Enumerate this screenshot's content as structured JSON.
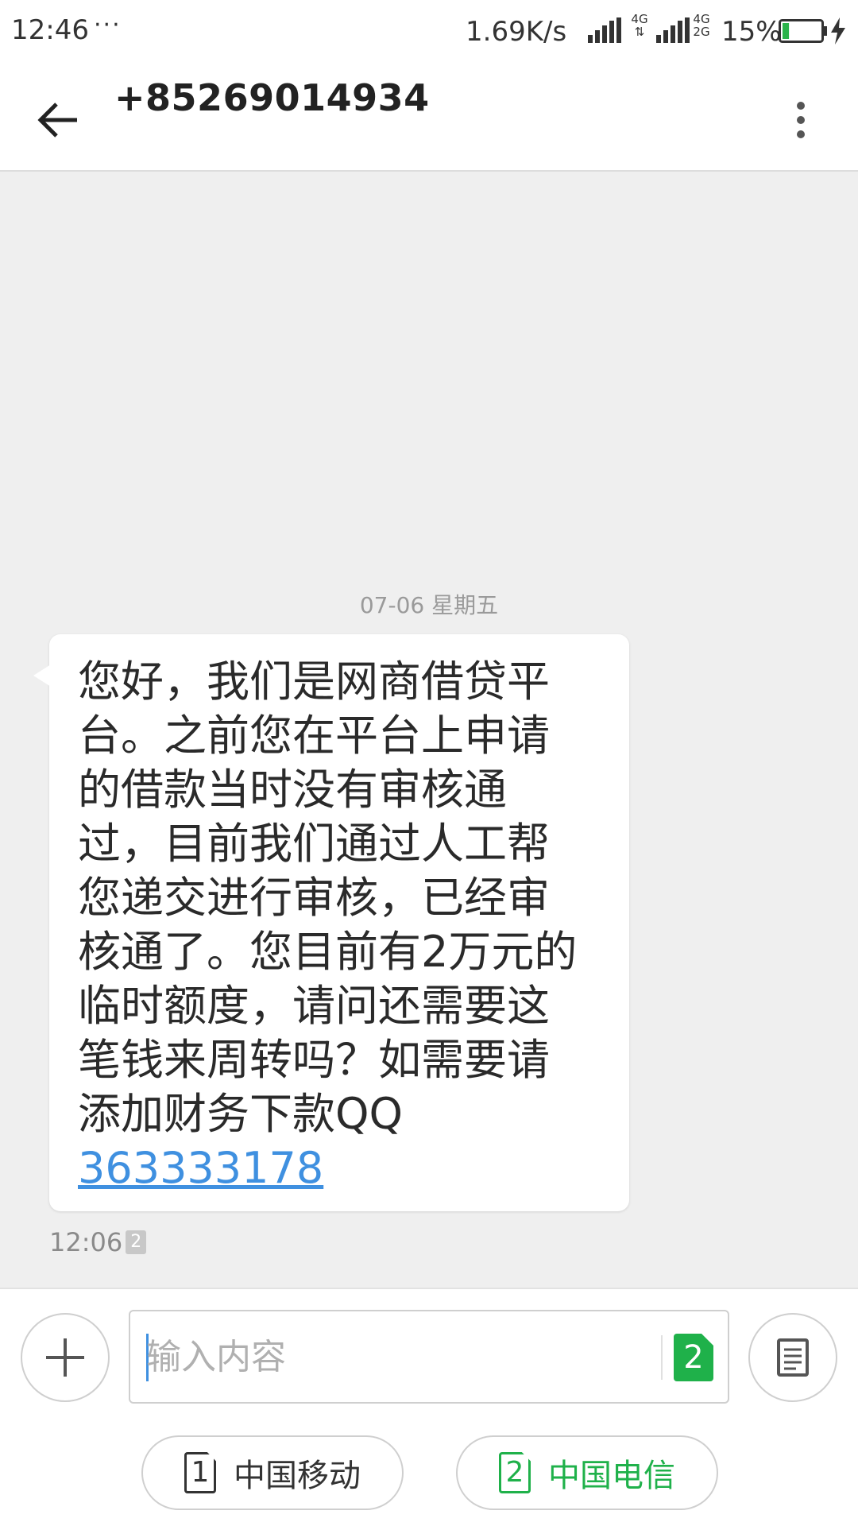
{
  "status_bar": {
    "time": "12:46",
    "more": "···",
    "net_speed": "1.69K/s",
    "network1": "4G",
    "network2_top": "4G",
    "network2_bottom": "2G",
    "battery_pct": "15%",
    "battery_level": 0.15,
    "battery_color": "#2ab34a"
  },
  "header": {
    "contact": "+85269014934"
  },
  "conversation": {
    "date": "07-06  星期五",
    "message_text": "您好，我们是网商借贷平台。之前您在平台上申请的借款当时没有审核通过，目前我们通过人工帮您递交进行审核，已经审核通了。您目前有2万元的临时额度，请问还需要这笔钱来周转吗？如需要请添加财务下款QQ",
    "message_link": "363333178",
    "time": "12:06",
    "sim_badge": "2"
  },
  "composer": {
    "placeholder": "输入内容",
    "send_sim": "2",
    "sim1_number": "1",
    "sim1_label": "中国移动",
    "sim2_number": "2",
    "sim2_label": "中国电信"
  },
  "colors": {
    "accent_green": "#1fb14a",
    "link_blue": "#3f90e0"
  }
}
